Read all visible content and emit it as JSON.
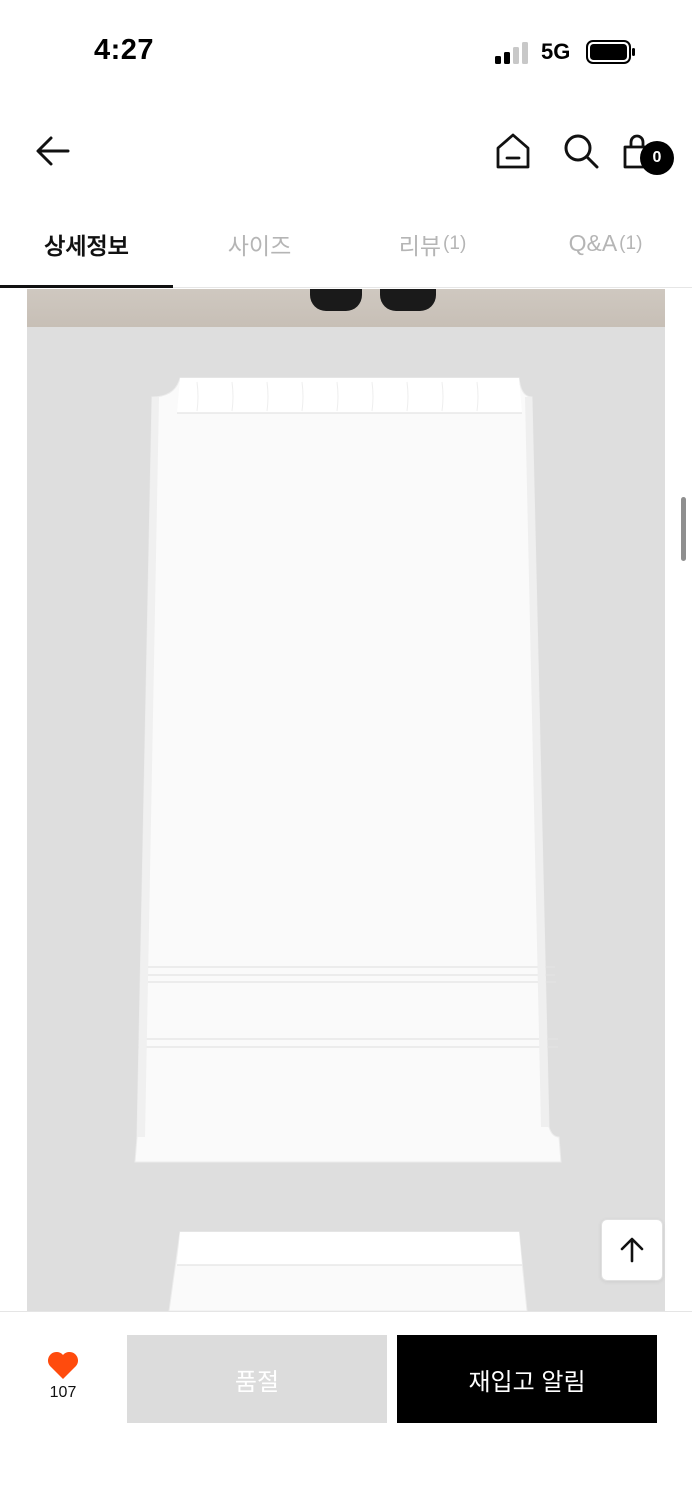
{
  "status_bar": {
    "time": "4:27",
    "network": "5G"
  },
  "header": {
    "cart_count": "0"
  },
  "tabs": [
    {
      "label": "상세정보",
      "count": ""
    },
    {
      "label": "사이즈",
      "count": ""
    },
    {
      "label": "리뷰",
      "count": "(1)"
    },
    {
      "label": "Q&A",
      "count": "(1)"
    }
  ],
  "active_tab": "상세정보",
  "bottom_bar": {
    "like_count": "107",
    "soldout_label": "품절",
    "restock_label": "재입고 알림"
  },
  "colors": {
    "accent_heart": "#ff4b0d",
    "primary_button": "#000000",
    "disabled_button": "#dcdcdc",
    "image_background": "#dedede"
  },
  "icons": [
    "back-arrow-icon",
    "home-icon",
    "search-icon",
    "shopping-bag-icon",
    "heart-icon",
    "arrow-up-icon"
  ]
}
